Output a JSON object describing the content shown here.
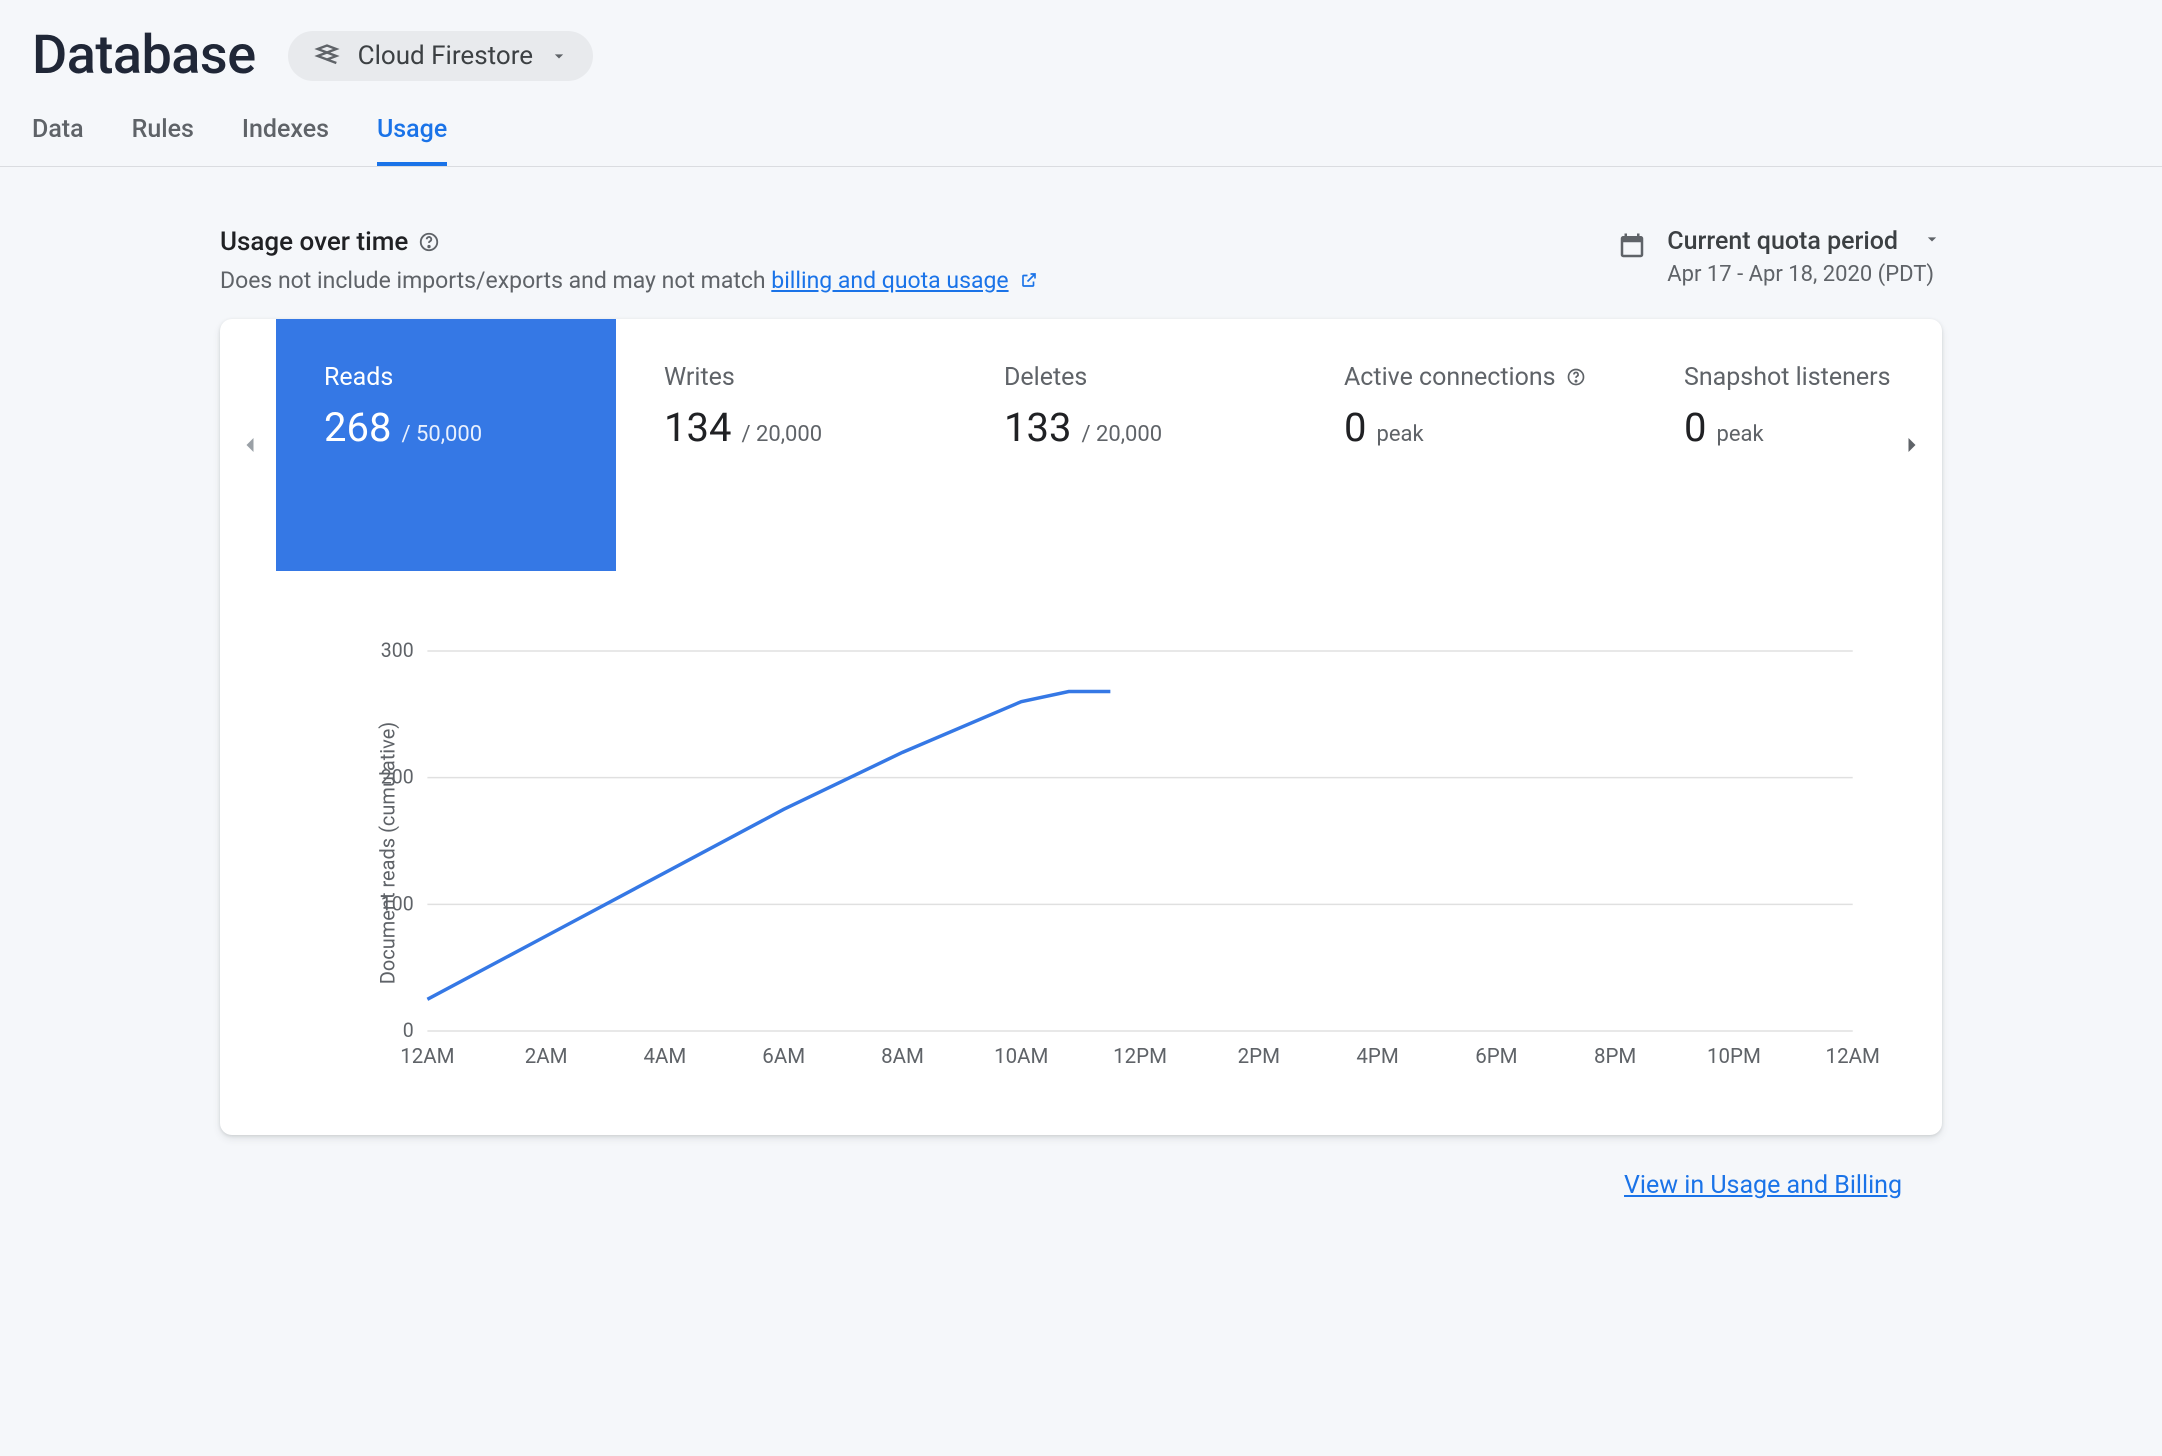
{
  "header": {
    "title": "Database",
    "selector_label": "Cloud Firestore"
  },
  "tabs": [
    {
      "label": "Data",
      "active": false
    },
    {
      "label": "Rules",
      "active": false
    },
    {
      "label": "Indexes",
      "active": false
    },
    {
      "label": "Usage",
      "active": true
    }
  ],
  "section": {
    "title": "Usage over time",
    "subtitle_prefix": "Does not include imports/exports and may not match ",
    "subtitle_link": "billing and quota usage"
  },
  "period": {
    "label": "Current quota period",
    "range": "Apr 17 - Apr 18, 2020 (PDT)"
  },
  "metrics": [
    {
      "title": "Reads",
      "value": "268",
      "limit": "/ 50,000",
      "active": true
    },
    {
      "title": "Writes",
      "value": "134",
      "limit": "/ 20,000",
      "active": false
    },
    {
      "title": "Deletes",
      "value": "133",
      "limit": "/ 20,000",
      "active": false
    },
    {
      "title": "Active connections",
      "value": "0",
      "limit": "peak",
      "active": false,
      "help": true
    },
    {
      "title": "Snapshot listeners",
      "value": "0",
      "limit": "peak",
      "active": false
    }
  ],
  "footer": {
    "link": "View in Usage and Billing"
  },
  "chart_data": {
    "type": "line",
    "title": "",
    "xlabel": "",
    "ylabel": "Document reads (cumulative)",
    "ylim": [
      0,
      300
    ],
    "yticks": [
      0,
      100,
      200,
      300
    ],
    "categories": [
      "12AM",
      "2AM",
      "4AM",
      "6AM",
      "8AM",
      "10AM",
      "12PM",
      "2PM",
      "4PM",
      "6PM",
      "8PM",
      "10PM",
      "12AM"
    ],
    "series": [
      {
        "name": "Reads",
        "x": [
          0,
          2,
          4,
          6,
          8,
          10,
          10.8,
          11.5
        ],
        "values": [
          25,
          75,
          125,
          175,
          220,
          260,
          268,
          268
        ]
      }
    ]
  }
}
